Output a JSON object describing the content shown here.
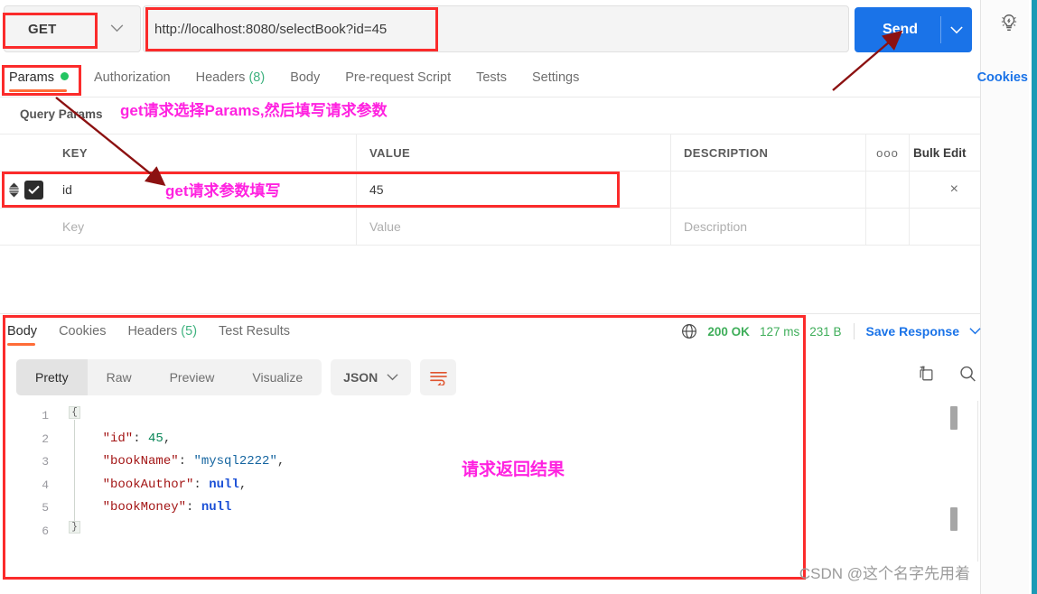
{
  "request": {
    "method": "GET",
    "url": "http://localhost:8080/selectBook?id=45",
    "send_label": "Send",
    "cookies_link": "Cookies",
    "tabs": [
      {
        "label": "Params",
        "active": true,
        "dot": true
      },
      {
        "label": "Authorization",
        "active": false
      },
      {
        "label": "Headers",
        "count": "(8)",
        "active": false
      },
      {
        "label": "Body",
        "active": false
      },
      {
        "label": "Pre-request Script",
        "active": false
      },
      {
        "label": "Tests",
        "active": false
      },
      {
        "label": "Settings",
        "active": false
      }
    ]
  },
  "params": {
    "section_title": "Query Params",
    "headers": [
      "KEY",
      "VALUE",
      "DESCRIPTION"
    ],
    "bulk_edit": "Bulk Edit",
    "more_dots": "ooo",
    "rows": [
      {
        "checked": true,
        "key": "id",
        "value": "45",
        "description": "",
        "remove": "×"
      },
      {
        "checked": false,
        "key": "",
        "value": "",
        "description": "",
        "key_placeholder": "Key",
        "value_placeholder": "Value",
        "description_placeholder": "Description"
      }
    ]
  },
  "response": {
    "tabs": [
      {
        "label": "Body",
        "active": true
      },
      {
        "label": "Cookies",
        "active": false
      },
      {
        "label": "Headers",
        "count": "(5)",
        "active": false
      },
      {
        "label": "Test Results",
        "active": false
      }
    ],
    "status": {
      "code": "200 OK",
      "time": "127 ms",
      "size": "231 B"
    },
    "save_response": "Save Response",
    "view_modes": [
      {
        "label": "Pretty",
        "active": true
      },
      {
        "label": "Raw",
        "active": false
      },
      {
        "label": "Preview",
        "active": false
      },
      {
        "label": "Visualize",
        "active": false
      }
    ],
    "format": "JSON",
    "line_numbers": [
      "1",
      "2",
      "3",
      "4",
      "5",
      "6"
    ],
    "body_json": {
      "id": 45,
      "bookName": "mysql2222",
      "bookAuthor": null,
      "bookMoney": null
    },
    "code_lines": [
      "{",
      "    \"id\": 45,",
      "    \"bookName\": \"mysql2222\",",
      "    \"bookAuthor\": null,",
      "    \"bookMoney\": null",
      "}"
    ]
  },
  "annotations": {
    "note_params": "get请求选择Params,然后填写请求参数",
    "note_param_fill": "get请求参数填写",
    "note_result": "请求返回结果"
  },
  "watermark": "CSDN @这个名字先用着",
  "colors": {
    "accent_orange": "#ff6c37",
    "send_blue": "#1a73e8",
    "status_green": "#3fae5a",
    "annotation_red": "#fb2b2b",
    "annotation_pink": "#ff22e0"
  }
}
